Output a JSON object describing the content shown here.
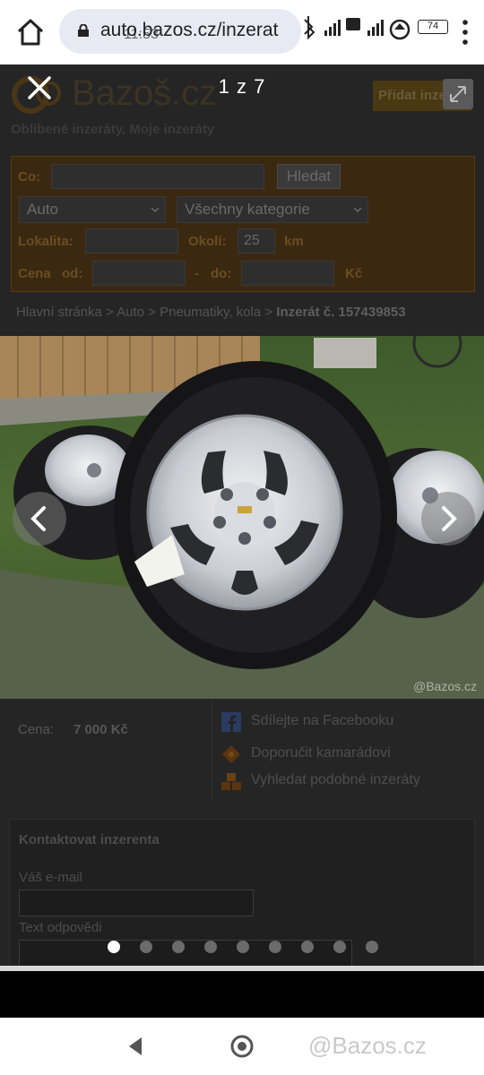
{
  "browser": {
    "status_time": "11:53",
    "url": "auto.bazos.cz/inzerat",
    "battery": "74"
  },
  "site": {
    "logo_text": "Bazoš.cz",
    "add_ad_button": "Přidat inzerát",
    "fav_links": "Oblíbené inzeráty, Moje inzeráty"
  },
  "search": {
    "co_label": "Co:",
    "search_button": "Hledat",
    "category_select": "Auto",
    "subcategory_select": "Všechny kategorie",
    "location_label": "Lokalita:",
    "radius_label": "Okolí:",
    "radius_value": "25",
    "radius_unit": "km",
    "price_label": "Cena",
    "price_from": "od:",
    "price_dash": "-",
    "price_to": "do:",
    "currency": "Kč"
  },
  "breadcrumb": {
    "path": "Hlavní stránka > Auto > Pneumatiky, kola > ",
    "current": "Inzerát č. 157439853"
  },
  "viewer": {
    "counter": "1 z 7",
    "photo_watermark": "@Bazos.cz",
    "current_index": 1,
    "total": 9
  },
  "listing": {
    "price_label": "Cena:",
    "price_value": "7 000 Kč",
    "share_facebook": "Sdílejte na Facebooku",
    "recommend": "Doporučit kamarádovi",
    "similar": "Vyhledat podobné inzeráty"
  },
  "contact": {
    "title": "Kontaktovat inzerenta",
    "email_label": "Váš e-mail",
    "reply_label": "Text odpovědi"
  },
  "system_nav": {
    "watermark": "@Bazos.cz"
  },
  "colors": {
    "site_orange": "#3b2810",
    "facebook_blue": "#2a3b62"
  }
}
